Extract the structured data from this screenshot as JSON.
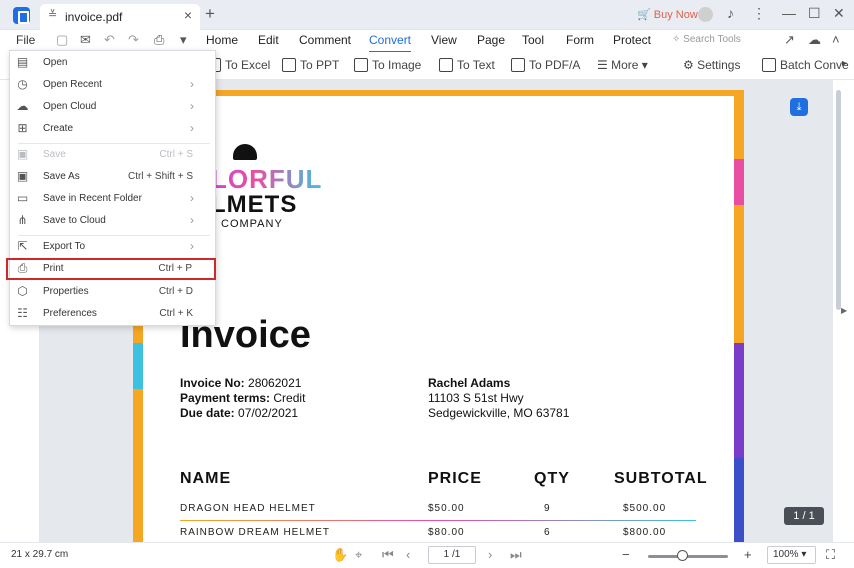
{
  "titlebar": {
    "tab_title": "invoice.pdf",
    "buy_now": "Buy Now",
    "close_glyph": "×",
    "add_glyph": "+",
    "minimize_glyph": "—",
    "maximize_glyph": "☐",
    "window_close_glyph": "✕",
    "more_glyph": "⋮"
  },
  "nav": {
    "file": "File",
    "items": [
      "Home",
      "Edit",
      "Comment",
      "Convert",
      "View",
      "Page",
      "Tool",
      "Form",
      "Protect"
    ],
    "active": "Convert",
    "search_placeholder": "Search Tools"
  },
  "toolbar": {
    "items": [
      "To Excel",
      "To PPT",
      "To Image",
      "To Text",
      "To PDF/A",
      "More",
      "Settings",
      "Batch Conve"
    ]
  },
  "file_menu": {
    "items": [
      {
        "label": "Open",
        "shortcut": "",
        "submenu": false,
        "disabled": false,
        "icon": "open-icon"
      },
      {
        "label": "Open Recent",
        "shortcut": "",
        "submenu": true,
        "disabled": false,
        "icon": "clock-icon"
      },
      {
        "label": "Open Cloud",
        "shortcut": "",
        "submenu": true,
        "disabled": false,
        "icon": "cloud-icon"
      },
      {
        "label": "Create",
        "shortcut": "",
        "submenu": true,
        "disabled": false,
        "icon": "create-icon"
      },
      {
        "label": "Save",
        "shortcut": "Ctrl + S",
        "submenu": false,
        "disabled": true,
        "icon": "save-icon"
      },
      {
        "label": "Save As",
        "shortcut": "Ctrl + Shift + S",
        "submenu": false,
        "disabled": false,
        "icon": "save-as-icon"
      },
      {
        "label": "Save in Recent Folder",
        "shortcut": "",
        "submenu": true,
        "disabled": false,
        "icon": "folder-icon"
      },
      {
        "label": "Save to Cloud",
        "shortcut": "",
        "submenu": true,
        "disabled": false,
        "icon": "share-icon"
      },
      {
        "label": "Export To",
        "shortcut": "",
        "submenu": true,
        "disabled": false,
        "icon": "export-icon"
      },
      {
        "label": "Print",
        "shortcut": "Ctrl + P",
        "submenu": false,
        "disabled": false,
        "icon": "print-icon"
      },
      {
        "label": "Properties",
        "shortcut": "Ctrl + D",
        "submenu": false,
        "disabled": false,
        "icon": "properties-icon"
      },
      {
        "label": "Preferences",
        "shortcut": "Ctrl + K",
        "submenu": false,
        "disabled": false,
        "icon": "preferences-icon"
      }
    ],
    "highlighted": "Print",
    "highlight_color": "#cc2a2a"
  },
  "document": {
    "logo_line1": "LORFUL",
    "logo_line2": "LMETS",
    "logo_line3": "COMPANY",
    "title": "Invoice",
    "invoice_no_label": "Invoice No:",
    "invoice_no": "28062021",
    "payment_terms_label": "Payment terms:",
    "payment_terms": "Credit",
    "due_date_label": "Due date:",
    "due_date": "07/02/2021",
    "bill_to_name": "Rachel Adams",
    "bill_to_address1": "11103 S 51st Hwy",
    "bill_to_address2": "Sedgewickville, MO 63781",
    "columns": [
      "NAME",
      "PRICE",
      "QTY",
      "SUBTOTAL"
    ],
    "rows": [
      {
        "name": "DRAGON HEAD HELMET",
        "price": "$50.00",
        "qty": "9",
        "subtotal": "$500.00"
      },
      {
        "name": "RAINBOW DREAM HELMET",
        "price": "$80.00",
        "qty": "6",
        "subtotal": "$800.00"
      }
    ]
  },
  "page_badge": "1 / 1",
  "status": {
    "dimensions": "21 x 29.7 cm",
    "page": "1 /1",
    "zoom": "100%",
    "zoom_fraction": 0.37
  },
  "colors": {
    "accent": "#1f6fe0",
    "buy_now": "#e0604a"
  }
}
